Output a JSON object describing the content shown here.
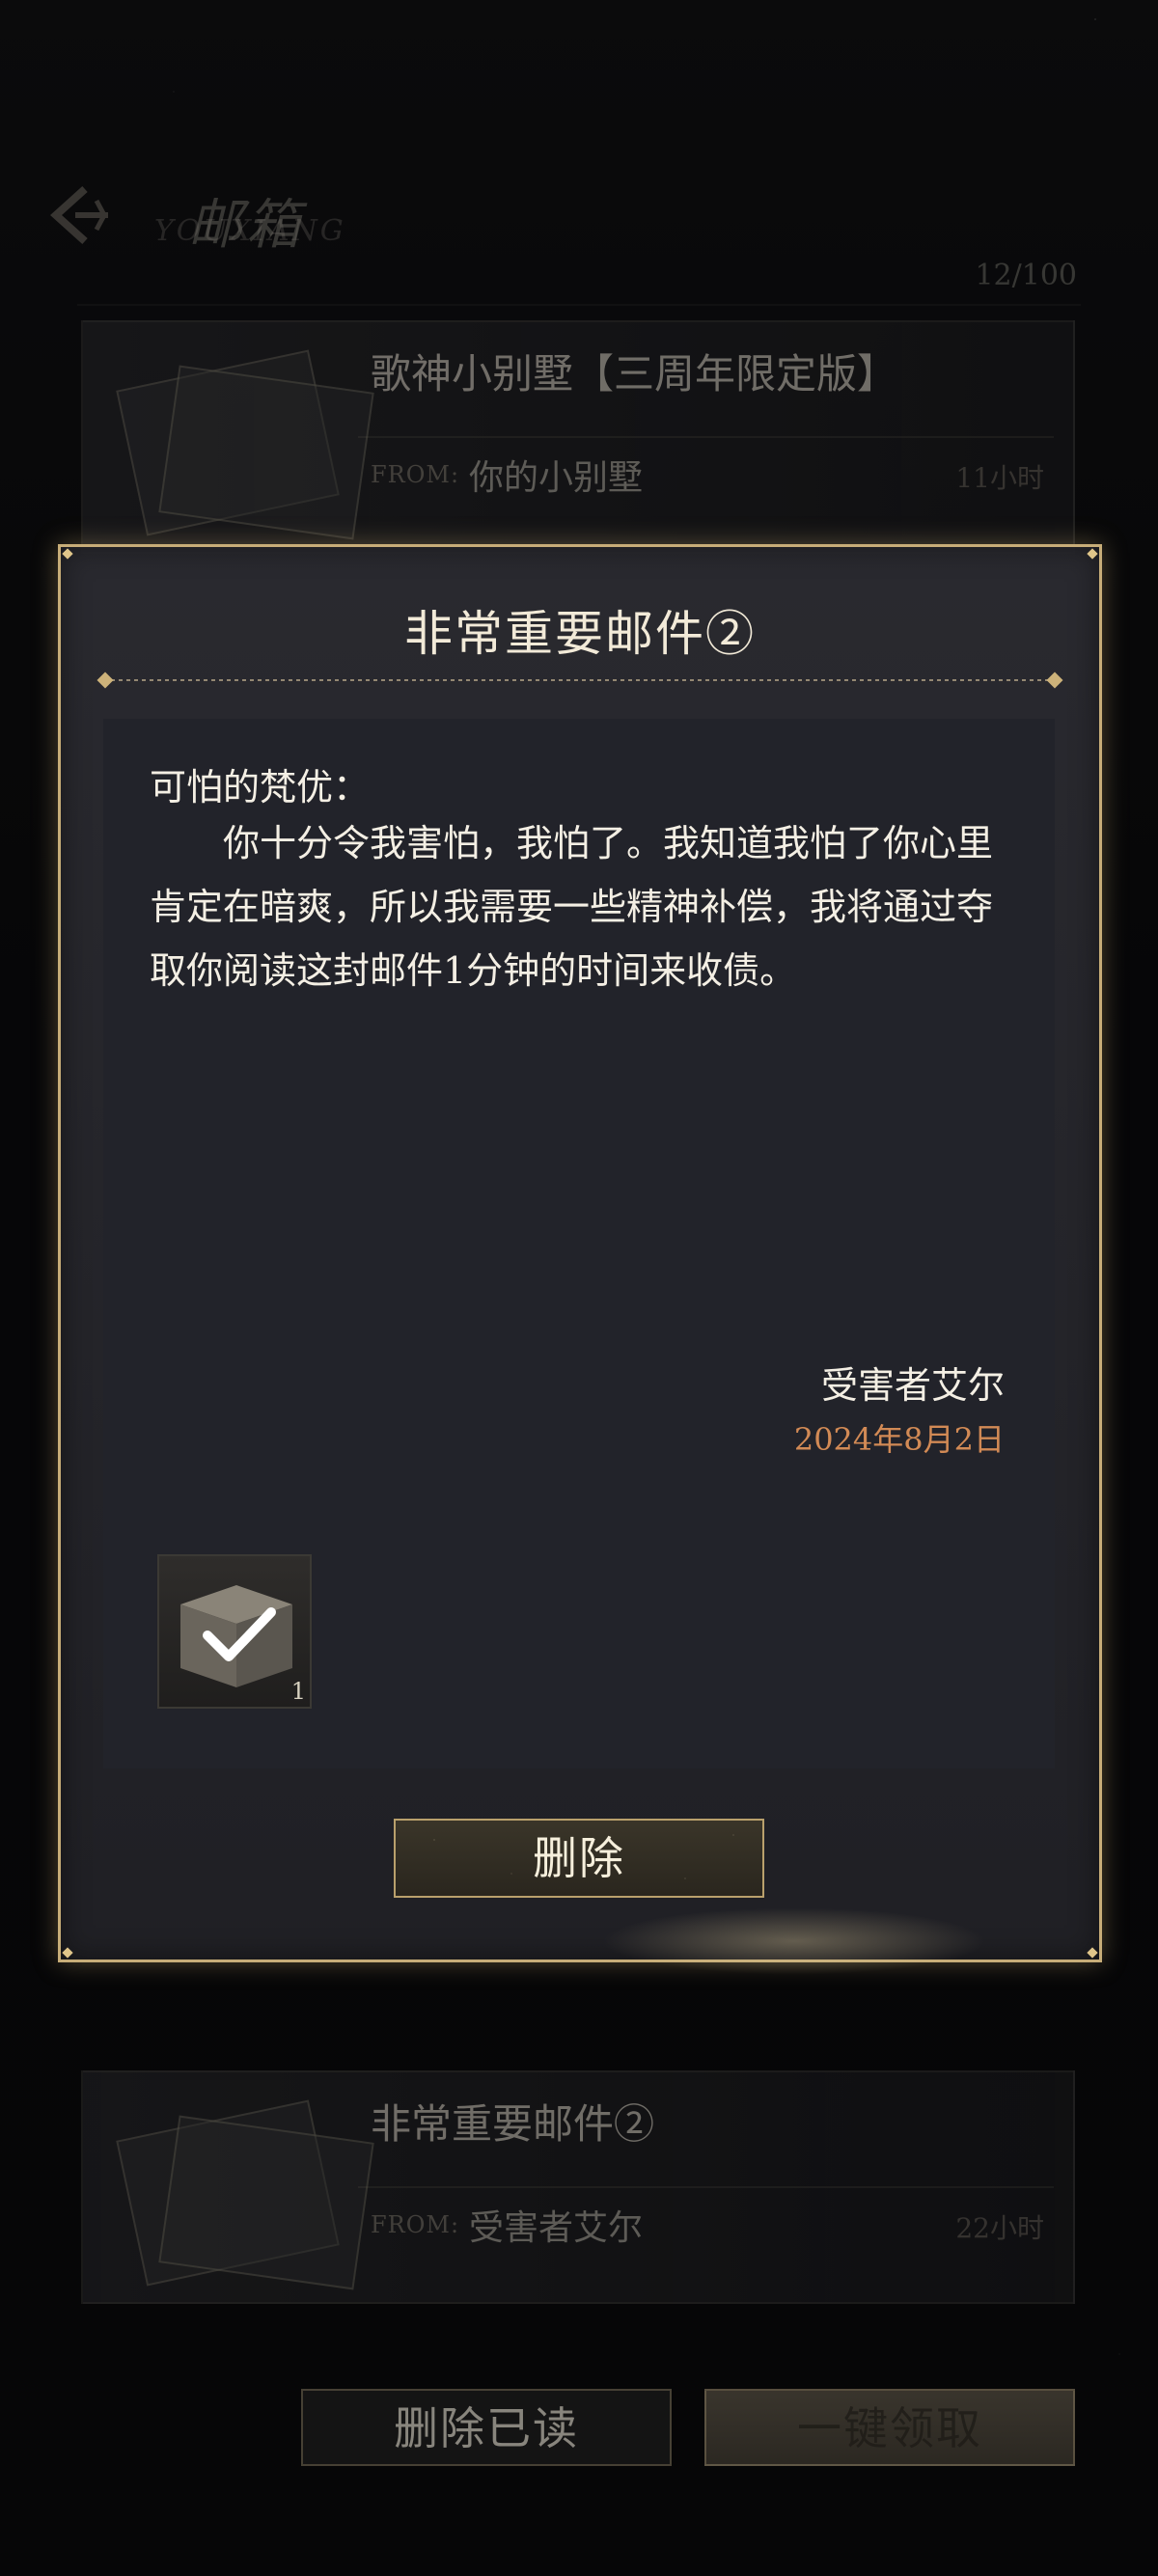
{
  "header": {
    "title": "邮箱",
    "subtitle": "YOUXIANG",
    "mail_count": "12/100"
  },
  "mail_list": [
    {
      "title": "歌神小别墅【三周年限定版】",
      "from_label": "FROM:",
      "from": "你的小别墅",
      "time": "11小时"
    },
    {
      "title": "非常重要邮件②",
      "from_label": "FROM:",
      "from": "受害者艾尔",
      "time": "22小时"
    }
  ],
  "dialog": {
    "title": "非常重要邮件②",
    "salutation": "可怕的梵优：",
    "body": "你十分令我害怕，我怕了。我知道我怕了你心里肯定在暗爽，所以我需要一些精神补偿，我将通过夺取你阅读这封邮件1分钟的时间来收债。",
    "signature": "受害者艾尔",
    "date": "2024年8月2日",
    "attachment": {
      "icon": "box-check-icon",
      "quantity": "1"
    },
    "delete_label": "删除"
  },
  "footer": {
    "delete_read_label": "删除已读",
    "claim_all_label": "一键领取"
  },
  "colors": {
    "accent_gold": "#c7ad78",
    "date_orange": "#d28a55",
    "panel": "#22232a"
  }
}
